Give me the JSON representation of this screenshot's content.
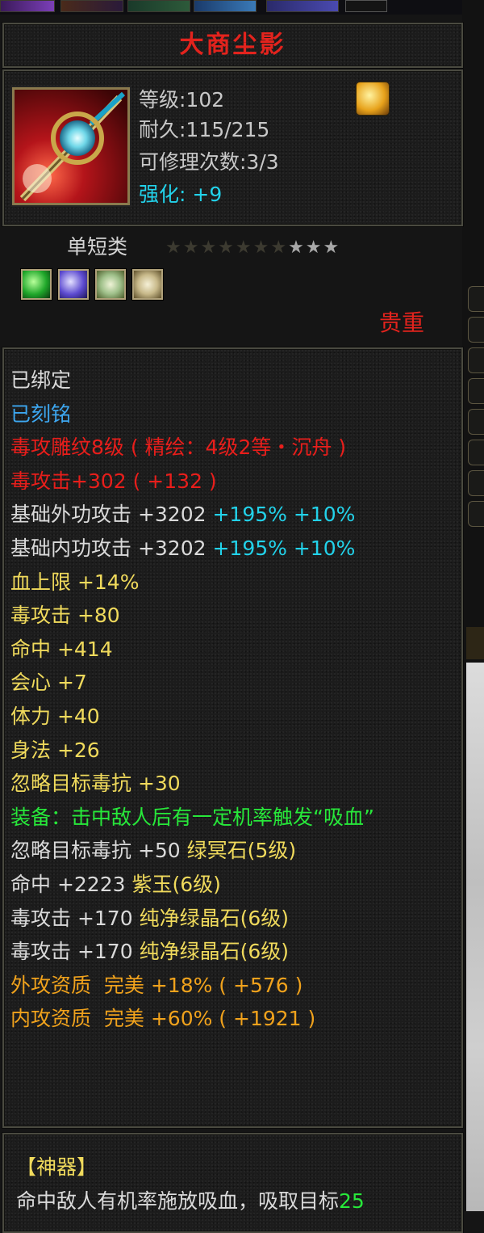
{
  "item": {
    "title": "大商尘影",
    "level": "等级:102",
    "durability": "耐久:115/215",
    "repairs": "可修理次数:3/3",
    "enhance_label": "强化",
    "enhance_value": ": +9",
    "category": "单短类",
    "stars_dim": "★★★★★★★",
    "stars_lit": "★★★",
    "valuable": "贵重",
    "icon": "jade-sword-icon",
    "badge_icon": "golden-enchant-icon",
    "gems": [
      "green-gem-icon",
      "purple-gem-icon",
      "jade-gem-icon",
      "jade-gem-icon"
    ]
  },
  "stats": [
    {
      "text": "已绑定",
      "color": "white"
    },
    {
      "text": "已刻铭",
      "color": "blue"
    },
    {
      "text": "毒攻雕纹8级 ( 精绘：4级2等・沉舟 )",
      "color": "red"
    },
    {
      "text": "毒攻击+302 ( +132 )",
      "color": "red"
    },
    {
      "text": "基础外功攻击 +3202",
      "extra": [
        " +195%",
        " +10%"
      ],
      "color": "white"
    },
    {
      "text": "基础内功攻击 +3202",
      "extra": [
        " +195%",
        " +10%"
      ],
      "color": "white"
    },
    {
      "text": "血上限 +14%",
      "color": "yellow"
    },
    {
      "text": "毒攻击 +80",
      "color": "yellow"
    },
    {
      "text": "命中 +414",
      "color": "yellow"
    },
    {
      "text": "会心 +7",
      "color": "yellow"
    },
    {
      "text": "体力 +40",
      "color": "yellow"
    },
    {
      "text": "身法 +26",
      "color": "yellow"
    },
    {
      "text": "忽略目标毒抗 +30",
      "color": "yellow"
    },
    {
      "text": "装备：击中敌人后有一定机率触发“吸血”",
      "color": "green"
    },
    {
      "text": "忽略目标毒抗 +50",
      "suffix": " 绿冥石(5级)",
      "color": "white"
    },
    {
      "text": "命中 +2223",
      "suffix": " 紫玉(6级)",
      "color": "white"
    },
    {
      "text": "毒攻击 +170",
      "suffix": " 纯净绿晶石(6级)",
      "color": "white"
    },
    {
      "text": "毒攻击 +170",
      "suffix": " 纯净绿晶石(6级)",
      "color": "white"
    },
    {
      "text": "外攻资质  完美 +18% ( +576 )",
      "color": "orange"
    },
    {
      "text": "内攻资质  完美 +60% ( +1921 )",
      "color": "orange"
    }
  ],
  "artifact": {
    "header": "【神器】",
    "desc": "命中敌人有机率施放吸血，吸取目标",
    "value": "25"
  },
  "colors": {
    "title": "#e3231d",
    "enhance": "#22d2ea",
    "panel_border": "#4a4a40"
  }
}
